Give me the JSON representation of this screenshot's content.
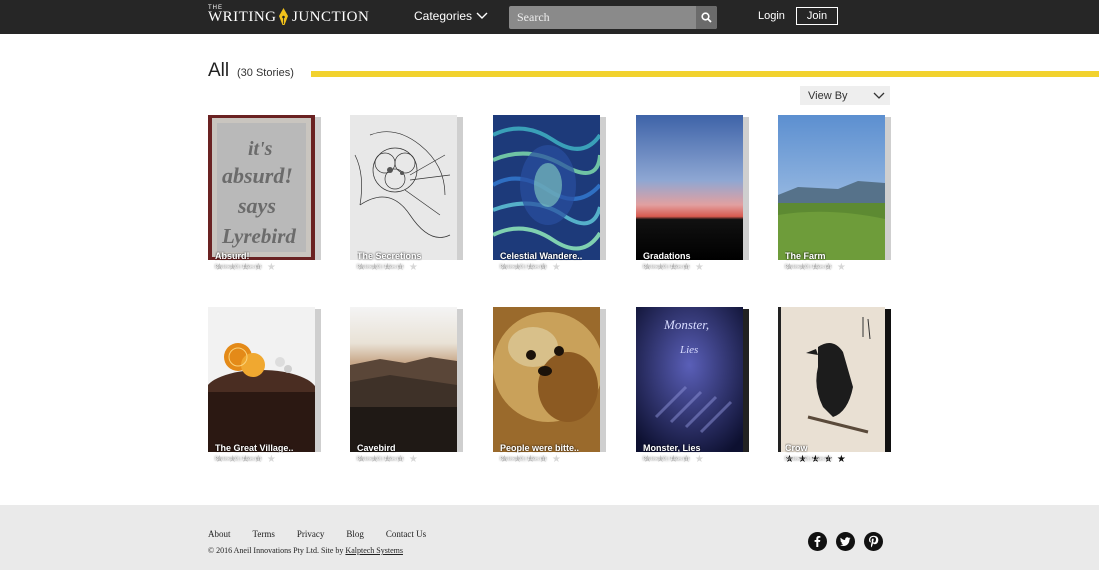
{
  "header": {
    "logo_small": "THE",
    "logo_part1": "WRITING",
    "logo_part2": "JUNCTION",
    "categories_label": "Categories",
    "search_placeholder": "Search",
    "login_label": "Login",
    "join_label": "Join"
  },
  "main": {
    "title": "All",
    "count": "(30 Stories)",
    "viewby_label": "View By"
  },
  "stories": [
    {
      "title": "Absurd!",
      "stats": "Reviews (0) | Likes (1)",
      "rating": 0
    },
    {
      "title": "The Secretions",
      "stats": "Reviews (0) | Likes (1)",
      "rating": 0
    },
    {
      "title": "Celestial Wandere..",
      "stats": "Reviews (0) | Likes (0)",
      "rating": 0
    },
    {
      "title": "Gradations",
      "stats": "Reviews (0) | Likes (1)",
      "rating": 0
    },
    {
      "title": "The Farm",
      "stats": "Reviews (0) | Likes (2)",
      "rating": 0
    },
    {
      "title": "The Great Village..",
      "stats": "Reviews (0) | Likes (1)",
      "rating": 0
    },
    {
      "title": "Cavebird",
      "stats": "Reviews (0) | Likes (1)",
      "rating": 0
    },
    {
      "title": "People were bitte..",
      "stats": "Reviews (0) | Likes (1)",
      "rating": 0
    },
    {
      "title": "Monster, Lies",
      "stats": "Reviews (0) | Likes (1)",
      "rating": 0
    },
    {
      "title": "Crow",
      "stats": "Reviews (0) | Likes (3)",
      "rating": 5
    }
  ],
  "cover_art": {
    "monster_text_1": "Monster,",
    "monster_text_2": "Lies",
    "absurd_text": "it's absurd! says Lyrebird"
  },
  "footer": {
    "links": [
      "About",
      "Terms",
      "Privacy",
      "Blog",
      "Contact Us"
    ],
    "copyright": "© 2016 Aneil Innovations Pty Ltd.  Site by ",
    "credit_link": "Kalptech Systems"
  },
  "colors": {
    "topbar": "#262626",
    "accent_yellow": "#f2d22e",
    "footer_bg": "#eaeaea"
  },
  "icons": [
    "search-icon",
    "chevron-down-icon",
    "star-icon",
    "facebook-icon",
    "twitter-icon",
    "pinterest-icon",
    "pen-nib-icon"
  ]
}
